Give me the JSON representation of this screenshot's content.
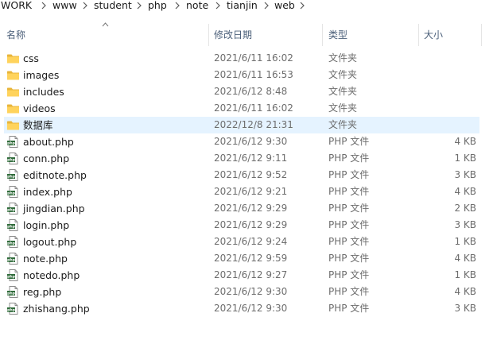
{
  "breadcrumb": [
    {
      "label": "WORK"
    },
    {
      "label": "www"
    },
    {
      "label": "student"
    },
    {
      "label": "php"
    },
    {
      "label": "note"
    },
    {
      "label": "tianjin"
    },
    {
      "label": "web"
    }
  ],
  "columns": {
    "name": "名称",
    "date": "修改日期",
    "type": "类型",
    "size": "大小",
    "sort_indicator": "sort-ascending-icon"
  },
  "files": [
    {
      "name": "css",
      "date": "2021/6/11 16:02",
      "type": "文件夹",
      "size": "",
      "icon": "folder-icon",
      "selected": false
    },
    {
      "name": "images",
      "date": "2021/6/11 16:53",
      "type": "文件夹",
      "size": "",
      "icon": "folder-icon",
      "selected": false
    },
    {
      "name": "includes",
      "date": "2021/6/12 8:48",
      "type": "文件夹",
      "size": "",
      "icon": "folder-icon",
      "selected": false
    },
    {
      "name": "videos",
      "date": "2021/6/11 16:02",
      "type": "文件夹",
      "size": "",
      "icon": "folder-icon",
      "selected": false
    },
    {
      "name": "数据库",
      "date": "2022/12/8 21:31",
      "type": "文件夹",
      "size": "",
      "icon": "folder-icon",
      "selected": true
    },
    {
      "name": "about.php",
      "date": "2021/6/12 9:30",
      "type": "PHP 文件",
      "size": "4 KB",
      "icon": "php-file-icon",
      "selected": false
    },
    {
      "name": "conn.php",
      "date": "2021/6/12 9:11",
      "type": "PHP 文件",
      "size": "1 KB",
      "icon": "php-file-icon",
      "selected": false
    },
    {
      "name": "editnote.php",
      "date": "2021/6/12 9:52",
      "type": "PHP 文件",
      "size": "3 KB",
      "icon": "php-file-icon",
      "selected": false
    },
    {
      "name": "index.php",
      "date": "2021/6/12 9:21",
      "type": "PHP 文件",
      "size": "4 KB",
      "icon": "php-file-icon",
      "selected": false
    },
    {
      "name": "jingdian.php",
      "date": "2021/6/12 9:29",
      "type": "PHP 文件",
      "size": "2 KB",
      "icon": "php-file-icon",
      "selected": false
    },
    {
      "name": "login.php",
      "date": "2021/6/12 9:29",
      "type": "PHP 文件",
      "size": "3 KB",
      "icon": "php-file-icon",
      "selected": false
    },
    {
      "name": "logout.php",
      "date": "2021/6/12 9:24",
      "type": "PHP 文件",
      "size": "1 KB",
      "icon": "php-file-icon",
      "selected": false
    },
    {
      "name": "note.php",
      "date": "2021/6/12 9:59",
      "type": "PHP 文件",
      "size": "4 KB",
      "icon": "php-file-icon",
      "selected": false
    },
    {
      "name": "notedo.php",
      "date": "2021/6/12 9:27",
      "type": "PHP 文件",
      "size": "1 KB",
      "icon": "php-file-icon",
      "selected": false
    },
    {
      "name": "reg.php",
      "date": "2021/6/12 9:30",
      "type": "PHP 文件",
      "size": "4 KB",
      "icon": "php-file-icon",
      "selected": false
    },
    {
      "name": "zhishang.php",
      "date": "2021/6/12 9:30",
      "type": "PHP 文件",
      "size": "3 KB",
      "icon": "php-file-icon",
      "selected": false
    }
  ],
  "colors": {
    "selected_row": "#e5f3ff",
    "folder": "#ffd35c",
    "header_text": "#4c607a",
    "secondary_text": "#6d6d6d"
  }
}
